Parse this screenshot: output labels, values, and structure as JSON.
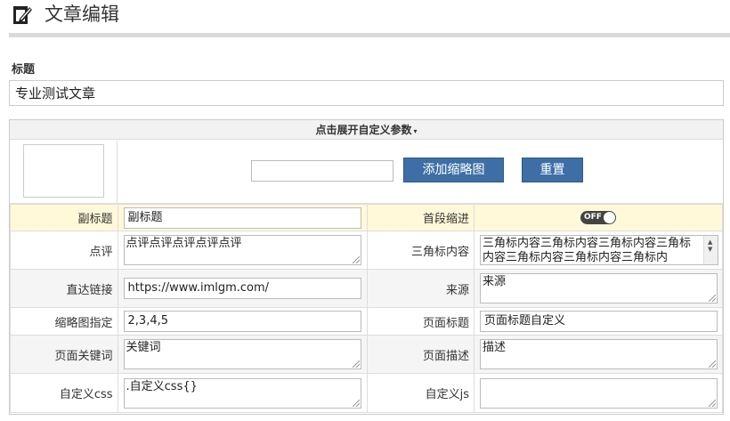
{
  "header": {
    "title": "文章编辑",
    "icon": "edit-icon"
  },
  "title_field": {
    "label": "标题",
    "value": "专业测试文章"
  },
  "panel": {
    "toggle_label": "点击展开自定义参数",
    "caret": "▾",
    "thumbnail": {
      "add_button": "添加缩略图",
      "reset_button": "重置",
      "input_value": ""
    },
    "fields": {
      "subtitle": {
        "label": "副标题",
        "value": "副标题"
      },
      "first_indent": {
        "label": "首段缩进",
        "toggle_text": "OFF"
      },
      "review": {
        "label": "点评",
        "value": "点评点评点评点评点评"
      },
      "triangle": {
        "label": "三角标内容",
        "value": "三角标内容三角标内容三角标内容三角标内容三角标内容三角标内容三角标内"
      },
      "direct_link": {
        "label": "直达链接",
        "value": "https://www.imlgm.com/"
      },
      "source": {
        "label": "来源",
        "value": "来源"
      },
      "thumb_spec": {
        "label": "缩略图指定",
        "value": "2,3,4,5"
      },
      "page_title": {
        "label": "页面标题",
        "value": "页面标题自定义"
      },
      "page_keywords": {
        "label": "页面关键词",
        "value": "关键词"
      },
      "page_desc": {
        "label": "页面描述",
        "value": "描述"
      },
      "custom_css": {
        "label": "自定义css",
        "value": ".自定义css{}"
      },
      "custom_js": {
        "label": "自定义js",
        "value": ""
      }
    }
  },
  "colors": {
    "accent_button": "#3d6fa6",
    "highlight_row": "#fff9d9"
  }
}
